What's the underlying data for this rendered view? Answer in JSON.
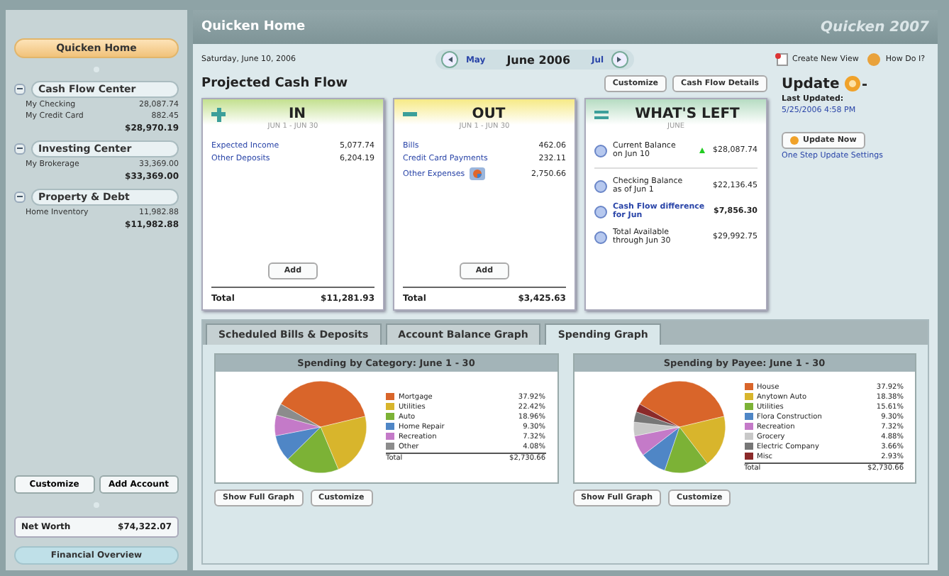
{
  "sidebar": {
    "home_button": "Quicken Home",
    "groups": [
      {
        "title": "Cash Flow Center",
        "expanded": true,
        "accounts": [
          {
            "name": "My Checking",
            "amount": "28,087.74"
          },
          {
            "name": "My Credit Card",
            "amount": "882.45"
          }
        ],
        "total": "$28,970.19"
      },
      {
        "title": "Investing Center",
        "expanded": true,
        "accounts": [
          {
            "name": "My Brokerage",
            "amount": "33,369.00"
          }
        ],
        "total": "$33,369.00"
      },
      {
        "title": "Property & Debt",
        "expanded": true,
        "accounts": [
          {
            "name": "Home Inventory",
            "amount": "11,982.88"
          }
        ],
        "total": "$11,982.88"
      }
    ],
    "buttons": [
      "Customize",
      "Add Account"
    ],
    "net_worth": {
      "label": "Net Worth",
      "value": "$74,322.07"
    },
    "overview_button": "Financial Overview"
  },
  "header": {
    "title": "Quicken Home",
    "logo": "Quicken",
    "logo_year": "2007"
  },
  "toolbar": {
    "date": "Saturday, June 10, 2006",
    "prev": "May",
    "month": "June 2006",
    "next": "Jul",
    "actions": [
      "Create New View",
      "How Do I?"
    ]
  },
  "cash_flow": {
    "title": "Projected Cash Flow",
    "buttons": [
      "Customize",
      "Cash Flow Details"
    ],
    "in": {
      "title": "IN",
      "range": "JUN 1 - JUN 30",
      "items": [
        {
          "label": "Expected Income",
          "amount": "5,077.74"
        },
        {
          "label": "Other Deposits",
          "amount": "6,204.19"
        }
      ],
      "add": "Add",
      "total_label": "Total",
      "total": "$11,281.93"
    },
    "out": {
      "title": "OUT",
      "range": "JUN 1 - JUN 30",
      "items": [
        {
          "label": "Bills",
          "amount": "462.06",
          "chart": false
        },
        {
          "label": "Credit Card Payments",
          "amount": "232.11",
          "chart": false
        },
        {
          "label": "Other Expenses",
          "amount": "2,750.66",
          "chart": true
        }
      ],
      "add": "Add",
      "total_label": "Total",
      "total": "$3,425.63"
    },
    "left": {
      "title": "WHAT'S LEFT",
      "range": "JUNE",
      "items": [
        {
          "label": "Current Balance",
          "sub": "on Jun 10",
          "amount": "$28,087.74",
          "up": true,
          "bold": false
        },
        {
          "label": "Checking Balance",
          "sub": "as of Jun 1",
          "amount": "$22,136.45",
          "up": false,
          "bold": false
        },
        {
          "label": "Cash Flow difference",
          "sub": "for Jun",
          "amount": "$7,856.30",
          "up": false,
          "bold": true
        },
        {
          "label": "Total Available",
          "sub": "through Jun 30",
          "amount": "$29,992.75",
          "up": false,
          "bold": false
        }
      ]
    }
  },
  "update": {
    "title": "Update",
    "last_label": "Last Updated:",
    "last_value": "5/25/2006  4:58 PM",
    "button": "Update Now",
    "link": "One Step Update Settings"
  },
  "tabs": [
    {
      "label": "Scheduled Bills & Deposits",
      "selected": false
    },
    {
      "label": "Account Balance Graph",
      "selected": false
    },
    {
      "label": "Spending Graph",
      "selected": true
    }
  ],
  "graphs": [
    {
      "chart_data": {
        "type": "pie",
        "title": "Spending by Category: June 1 - 30",
        "categories": [
          "Mortgage",
          "Utilities",
          "Auto",
          "Home Repair",
          "Recreation",
          "Other"
        ],
        "series": [
          {
            "values": [
              37.92,
              22.42,
              18.96,
              9.3,
              7.32,
              4.08
            ]
          }
        ]
      },
      "legend": [
        {
          "pct": "37.92%",
          "color": "#d9652a"
        },
        {
          "pct": "22.42%",
          "color": "#d8b52c"
        },
        {
          "pct": "18.96%",
          "color": "#7cb236"
        },
        {
          "pct": "9.30%",
          "color": "#4f86c6"
        },
        {
          "pct": "7.32%",
          "color": "#c47ac8"
        },
        {
          "pct": "4.08%",
          "color": "#8c8c8c"
        }
      ],
      "total_label": "Total",
      "total": "$2,730.66",
      "buttons": [
        "Show Full Graph",
        "Customize"
      ]
    },
    {
      "chart_data": {
        "type": "pie",
        "title": "Spending by Payee: June 1 - 30",
        "categories": [
          "House",
          "Anytown Auto",
          "Utilities",
          "Flora Construction",
          "Recreation",
          "Grocery",
          "Electric Company",
          "Misc"
        ],
        "series": [
          {
            "values": [
              37.92,
              18.38,
              15.61,
              9.3,
              7.32,
              4.88,
              3.66,
              2.93
            ]
          }
        ]
      },
      "legend": [
        {
          "pct": "37.92%",
          "color": "#d9652a"
        },
        {
          "pct": "18.38%",
          "color": "#d8b52c"
        },
        {
          "pct": "15.61%",
          "color": "#7cb236"
        },
        {
          "pct": "9.30%",
          "color": "#4f86c6"
        },
        {
          "pct": "7.32%",
          "color": "#c47ac8"
        },
        {
          "pct": "4.88%",
          "color": "#c8c8c8"
        },
        {
          "pct": "3.66%",
          "color": "#777777"
        },
        {
          "pct": "2.93%",
          "color": "#8b2a2a"
        }
      ],
      "total_label": "Total",
      "total": "$2,730.66",
      "buttons": [
        "Show Full Graph",
        "Customize"
      ]
    }
  ]
}
